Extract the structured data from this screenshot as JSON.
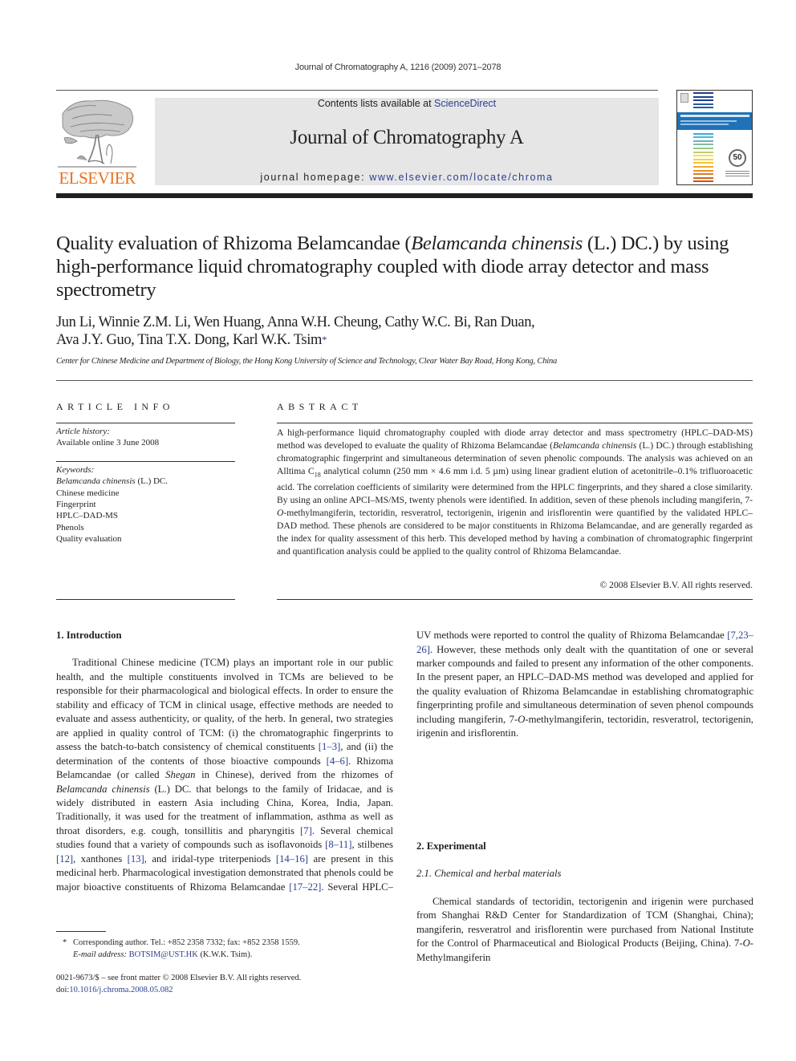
{
  "running_header": "Journal of Chromatography A, 1216 (2009) 2071–2078",
  "publisher": {
    "wordmark": "ELSEVIER",
    "brand_color": "#e9711c",
    "logo_icon": "elsevier-tree-icon"
  },
  "banner": {
    "contents_prefix": "Contents lists available at ",
    "contents_link": "ScienceDirect",
    "journal_title": "Journal of Chromatography A",
    "homepage_prefix": "journal homepage: ",
    "homepage_link": "www.elsevier.com/locate/chroma",
    "background": "#e6e6e6",
    "link_color": "#2a3f8f"
  },
  "cover": {
    "icon": "journal-cover-thumbnail",
    "badge": "50"
  },
  "article": {
    "title_part1": "Quality evaluation of Rhizoma Belamcandae (",
    "title_italic": "Belamcanda chinensis",
    "title_part2": " (L.) DC.) by using high-performance liquid chromatography coupled with diode array detector and mass spectrometry",
    "authors_line1": "Jun Li, Winnie Z.M. Li, Wen Huang, Anna W.H. Cheung, Cathy W.C. Bi, Ran Duan,",
    "authors_line2": "Ava J.Y. Guo, Tina T.X. Dong, Karl W.K. Tsim",
    "corresponding_mark": "*",
    "affiliation": "Center for Chinese Medicine and Department of Biology, the Hong Kong University of Science and Technology, Clear Water Bay Road, Hong Kong, China"
  },
  "article_info": {
    "heading": "ARTICLE INFO",
    "history_label": "Article history:",
    "history_value": "Available online 3 June 2008",
    "keywords_label": "Keywords:",
    "keyword_1_italic": "Belamcanda chinensis",
    "keyword_1_rest": " (L.) DC.",
    "keywords": [
      "Chinese medicine",
      "Fingerprint",
      "HPLC–DAD-MS",
      "Phenols",
      "Quality evaluation"
    ]
  },
  "abstract": {
    "heading": "ABSTRACT",
    "p1": "A high-performance liquid chromatography coupled with diode array detector and mass spectrometry (HPLC–DAD-MS) method was developed to evaluate the quality of Rhizoma Belamcandae (",
    "p1_italic": "Belamcanda chinensis",
    "p2": " (L.) DC.) through establishing chromatographic fingerprint and simultaneous determina­tion of seven phenolic compounds. The analysis was achieved on an Alltima C",
    "p2_sub": "18",
    "p3": " analytical column (250 mm × 4.6 mm i.d. 5 µm) using linear gradient elution of acetonitrile–0.1% trifluoroacetic acid. The correlation coefficients of similarity were determined from the HPLC fingerprints, and they shared a close similarity. By using an online APCI–MS/MS, twenty phenols were identified. In addition, seven of these phenols including mangiferin, 7-",
    "p3_italic_O": "O",
    "p4": "-methylmangiferin, tectoridin, resveratrol, tectorigenin, irigenin and irisflorentin were quantified by the validated HPLC–DAD method. These phenols are considered to be major constituents in Rhizoma Belamcandae, and are generally regarded as the index for quality assess­ment of this herb. This developed method by having a combination of chromatographic fingerprint and quantification analysis could be applied to the quality control of Rhizoma Belamcandae.",
    "copyright": "© 2008 Elsevier B.V. All rights reserved."
  },
  "body": {
    "sec1_heading": "1.  Introduction",
    "sec1_p": [
      {
        "t": "Traditional Chinese medicine (TCM) plays an important role in our public health, and the multiple constituents involved in TCMs are believed to be responsible for their pharmacological and biological effects. In order to ensure the stability and efficacy of TCM in clinical usage, effective methods are needed to eval­uate and assess authenticity, or quality, of the herb. In general, two strategies are applied in quality control of TCM: (i) the chro­matographic fingerprints to assess the batch-to-batch consistency of chemical constituents "
      },
      {
        "ref": "[1–3]"
      },
      {
        "t": ", and (ii) the determination of the contents of those bioactive compounds "
      },
      {
        "ref": "[4–6]"
      },
      {
        "t": ". Rhizoma Belamcan­dae (or called "
      },
      {
        "i": "Shegan"
      },
      {
        "t": " in Chinese), derived from the rhizomes of "
      },
      {
        "i": "Belamcanda chinensis"
      },
      {
        "t": " (L.) DC. that belongs to the family of Iridacae, and is widely distributed in eastern Asia including China, Korea, India, Japan. Traditionally, it was used for the treatment of inflam­mation, asthma as well as throat disorders, e.g. cough, tonsillitis and pharyngitis "
      },
      {
        "ref": "[7]"
      },
      {
        "t": ". Several chemical studies found that a variety of compounds such as isoflavonoids "
      },
      {
        "ref": "[8–11]"
      },
      {
        "t": ", stilbenes "
      },
      {
        "ref": "[12]"
      },
      {
        "t": ", xan­thones "
      },
      {
        "ref": "[13]"
      },
      {
        "t": ", and iridal-type triterpeniods "
      },
      {
        "ref": "[14–16]"
      },
      {
        "t": " are present in this medicinal herb. Pharmacological investigation demonstrated that phenols could be major bioactive constituents of Rhizoma Belamcandae "
      },
      {
        "ref": "[17–22]"
      },
      {
        "t": ". Several HPLC–UV methods were reported to control the quality of Rhizoma Belamcandae "
      },
      {
        "ref": "[7,23–26]"
      },
      {
        "t": ". However, these methods only dealt with the quantitation of one or several marker compounds and failed to present any information of the other components. In the present paper, an HPLC–DAD-MS method was developed and applied for the quality evaluation of Rhizoma Belamcandae in establishing chromatographic fingerprinting pro­file and simultaneous determination of seven phenol compounds including mangiferin, 7-"
      },
      {
        "i": "O"
      },
      {
        "t": "-methylmangiferin, tectoridin, resvera­trol, tectorigenin, irigenin and irisflorentin."
      }
    ],
    "sec2_heading": "2.  Experimental",
    "sec21_heading": "2.1.  Chemical and herbal materials",
    "sec21_p_start": "Chemical standards of tectoridin, tectorigenin and irigenin were purchased from Shanghai R&D Center for Standardization of TCM (Shanghai, China); mangiferin, resveratrol and irisflorentin were purchased from National Institute for the Control of Pharmaceuti­cal and Biological Products (Beijing, China). 7-",
    "sec21_p_italic": "O",
    "sec21_p_end": "-Methylmangiferin"
  },
  "footnote": {
    "mark": "*",
    "corresponding": "Corresponding author. Tel.: +852 2358 7332; fax: +852 2358 1559.",
    "email_label": "E-mail address: ",
    "email": "BOTSIM@UST.HK",
    "email_suffix": " (K.W.K. Tsim).",
    "issn_line": "0021-9673/$ – see front matter © 2008 Elsevier B.V. All rights reserved.",
    "doi_prefix": "doi:",
    "doi": "10.1016/j.chroma.2008.05.082"
  }
}
